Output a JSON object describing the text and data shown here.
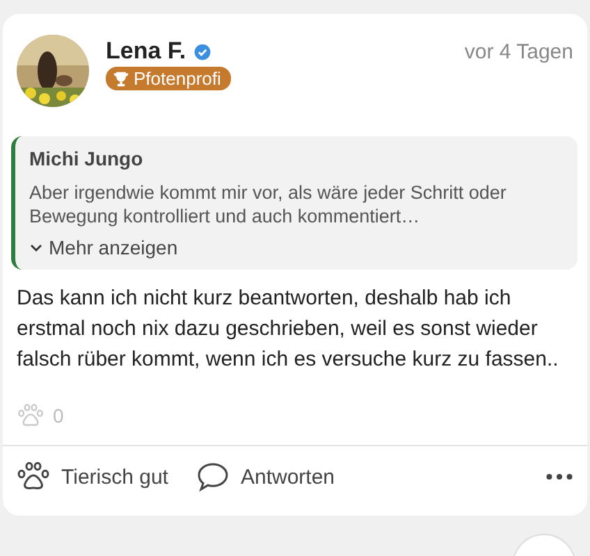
{
  "post": {
    "author": "Lena F.",
    "verified": true,
    "badge": "Pfotenprofi",
    "time": "vor 4 Tagen",
    "quote": {
      "author": "Michi Jungo",
      "text": "Aber irgendwie kommt mir vor, als wäre jeder Schritt oder Bewegung kontrolliert und auch kommentiert…",
      "more": "Mehr anzeigen"
    },
    "text": "Das kann ich nicht kurz beantworten, deshalb hab ich erstmal noch nix dazu geschrieben, weil es sonst wieder falsch rüber kommt, wenn ich es versuche kurz zu fassen..",
    "likes": "0",
    "actions": [
      {
        "kind": "like",
        "label": "Tierisch gut"
      },
      {
        "kind": "reply",
        "label": "Antworten"
      }
    ]
  }
}
